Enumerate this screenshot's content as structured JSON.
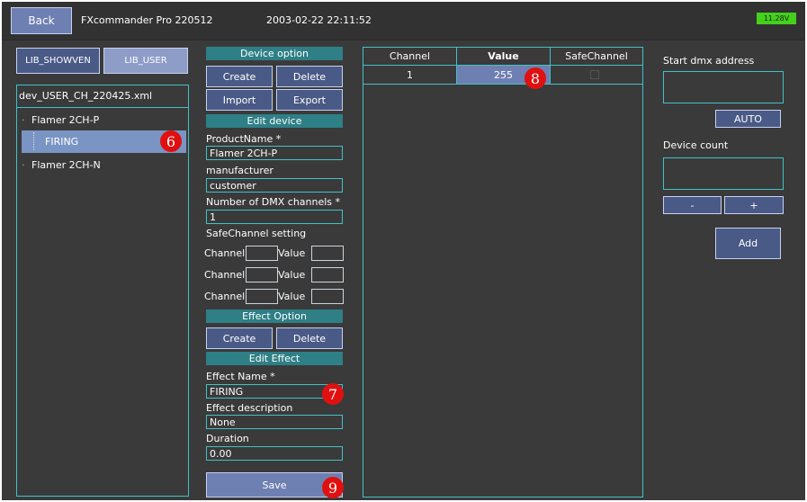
{
  "header": {
    "back_label": "Back",
    "app_title": "FXcommander Pro 220512",
    "datetime": "2003-02-22 22:11:52",
    "battery_label": "11.28V",
    "battery_color": "#43d11b"
  },
  "library": {
    "tabs": [
      {
        "label": "LIB_SHOWVEN"
      },
      {
        "label": "LIB_USER"
      }
    ],
    "active_tab": "LIB_USER",
    "file_name": "dev_USER_CH_220425.xml",
    "tree": [
      {
        "label": "Flamer 2CH-P",
        "prefix": "·"
      },
      {
        "label": "FIRING",
        "selected": true
      },
      {
        "label": "Flamer 2CH-N",
        "prefix": "·"
      }
    ]
  },
  "device_option": {
    "title": "Device option",
    "create_label": "Create",
    "delete_label": "Delete",
    "import_label": "Import",
    "export_label": "Export"
  },
  "edit_device": {
    "title": "Edit device",
    "product_name_label": "ProductName *",
    "product_name_value": "Flamer 2CH-P",
    "manufacturer_label": "manufacturer",
    "manufacturer_value": "customer",
    "dmx_channels_label": "Number of DMX channels *",
    "dmx_channels_value": "1",
    "safe_channel_label": "SafeChannel setting",
    "channel_label": "Channel",
    "value_label": "Value"
  },
  "effect_option": {
    "title": "Effect Option",
    "create_label": "Create",
    "delete_label": "Delete"
  },
  "edit_effect": {
    "title": "Edit Effect",
    "effect_name_label": "Effect Name *",
    "effect_name_value": "FIRING",
    "effect_desc_label": "Effect description",
    "effect_desc_value": "None",
    "duration_label": "Duration",
    "duration_value": "0.00"
  },
  "save_label": "Save",
  "channel_table": {
    "headers": [
      "Channel",
      "Value",
      "SafeChannel"
    ],
    "rows": [
      {
        "channel": "1",
        "value": "255",
        "safe": false
      }
    ]
  },
  "right_panel": {
    "start_dmx_label": "Start dmx address",
    "start_dmx_value": "",
    "auto_label": "AUTO",
    "device_count_label": "Device count",
    "device_count_value": "",
    "minus_label": "-",
    "plus_label": "+",
    "add_label": "Add"
  },
  "annotations": {
    "six": "6",
    "seven": "7",
    "eight": "8",
    "nine": "9"
  },
  "colors": {
    "accent": "#41c1c8",
    "button": "#4a5a86",
    "header": "#2f7f86",
    "selected": "#7a95c4",
    "value_cell": "#6e7fb2",
    "badge": "#e01010"
  }
}
